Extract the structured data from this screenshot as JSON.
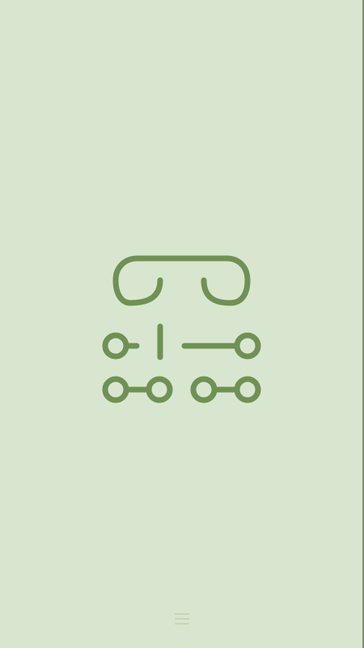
{
  "theme": {
    "background": "#d9e6cf",
    "tile_color": "#6f9153",
    "menu_color": "#c6d6b8"
  },
  "puzzle": {
    "name": "connection-tile-puzzle",
    "tiles": [
      {
        "id": "tile-curve-left",
        "shape": "curve"
      },
      {
        "id": "tile-curve-right",
        "shape": "curve"
      },
      {
        "id": "tile-endpoint-left",
        "shape": "endpoint"
      },
      {
        "id": "tile-straight-vertical",
        "shape": "straight"
      },
      {
        "id": "tile-straight-horizontal",
        "shape": "straight"
      },
      {
        "id": "tile-endpoint-right",
        "shape": "endpoint"
      },
      {
        "id": "tile-node-pair-left",
        "shape": "pair"
      },
      {
        "id": "tile-node-pair-right",
        "shape": "pair"
      }
    ]
  },
  "menu": {
    "icon": "hamburger-menu-icon"
  }
}
